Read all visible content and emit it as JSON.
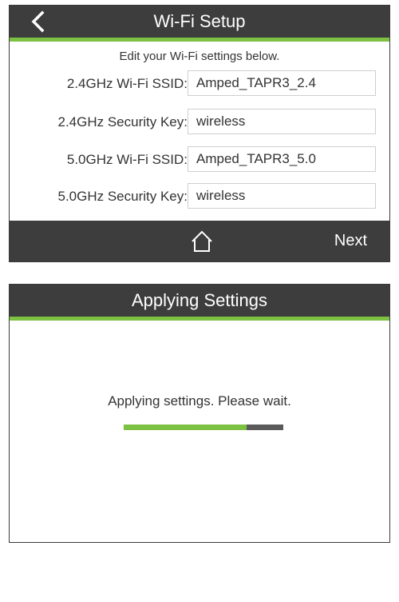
{
  "wifi_setup": {
    "title": "Wi-Fi Setup",
    "back_icon": "chevron-left-icon",
    "instructions": "Edit your Wi-Fi settings below.",
    "fields": [
      {
        "label": "2.4GHz Wi-Fi SSID:",
        "value": "Amped_TAPR3_2.4"
      },
      {
        "label": "2.4GHz Security Key:",
        "value": "wireless"
      },
      {
        "label": "5.0GHz Wi-Fi SSID:",
        "value": "Amped_TAPR3_5.0"
      },
      {
        "label": "5.0GHz Security Key:",
        "value": "wireless"
      }
    ],
    "home_icon": "home-icon",
    "next_label": "Next"
  },
  "applying": {
    "title": "Applying Settings",
    "message": "Applying settings. Please wait.",
    "progress_fraction": 0.77
  },
  "colors": {
    "bar_background": "#3d3d3d",
    "accent_green": "#7dc142",
    "progress_track": "#5a5a5a"
  }
}
